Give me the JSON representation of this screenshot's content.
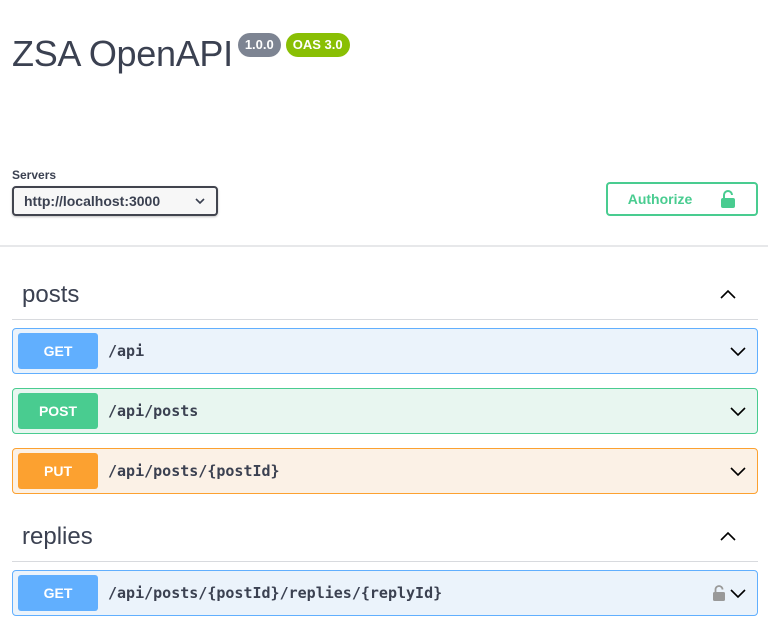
{
  "header": {
    "title": "ZSA OpenAPI",
    "version": "1.0.0",
    "oas": "OAS 3.0"
  },
  "servers": {
    "label": "Servers",
    "selected": "http://localhost:3000"
  },
  "authorize": {
    "label": "Authorize"
  },
  "tags": [
    {
      "name": "posts",
      "operations": [
        {
          "method": "GET",
          "path": "/api"
        },
        {
          "method": "POST",
          "path": "/api/posts"
        },
        {
          "method": "PUT",
          "path": "/api/posts/{postId}"
        }
      ]
    },
    {
      "name": "replies",
      "operations": [
        {
          "method": "GET",
          "path": "/api/posts/{postId}/replies/{replyId}",
          "locked": true
        }
      ]
    }
  ],
  "colors": {
    "get": "#61affe",
    "post": "#49cc90",
    "put": "#fca130",
    "authorize": "#49cc90"
  }
}
